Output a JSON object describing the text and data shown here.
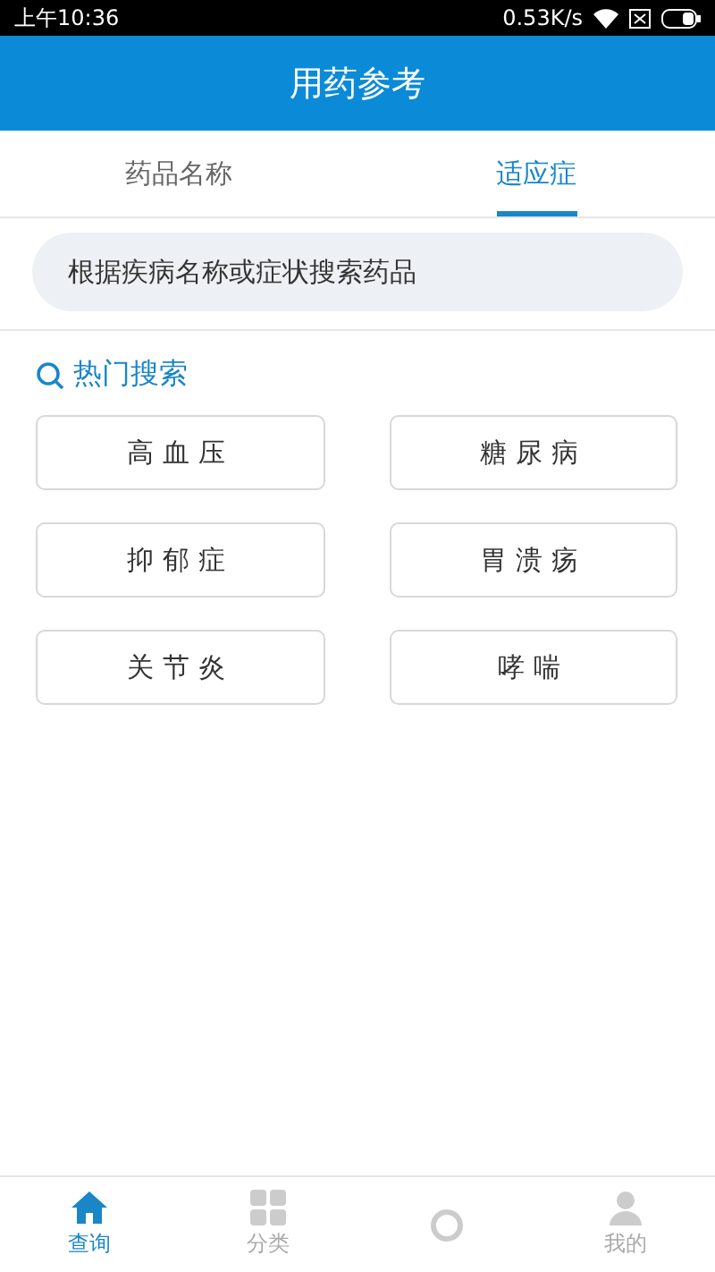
{
  "status_bar": {
    "time": "上午10:36",
    "speed": "0.53K/s"
  },
  "header": {
    "title": "用药参考"
  },
  "tabs": [
    {
      "label": "药品名称",
      "selected": false
    },
    {
      "label": "适应症",
      "selected": true
    }
  ],
  "search": {
    "placeholder": "根据疾病名称或症状搜索药品"
  },
  "hot_search": {
    "title": "热门搜索",
    "items": [
      "高血压",
      "糖尿病",
      "抑郁症",
      "胃溃疡",
      "关节炎",
      "哮喘"
    ]
  },
  "bottom_nav": [
    {
      "kind": "home",
      "label": "查询",
      "selected": true
    },
    {
      "kind": "grid",
      "label": "分类",
      "selected": false
    },
    {
      "kind": "ring",
      "selected": false
    },
    {
      "kind": "person",
      "label": "我的",
      "selected": false
    }
  ]
}
